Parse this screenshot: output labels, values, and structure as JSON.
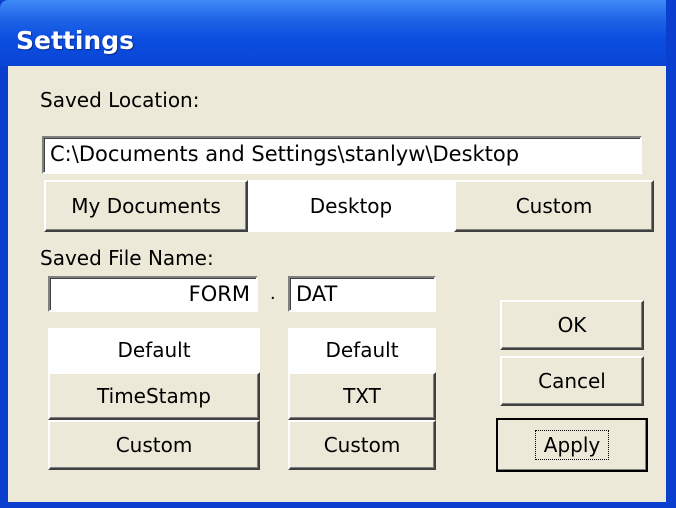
{
  "window": {
    "title": "Settings"
  },
  "location": {
    "label": "Saved Location:",
    "path": "C:\\Documents and Settings\\stanlyw\\Desktop",
    "buttons": [
      "My Documents",
      "Desktop",
      "Custom"
    ]
  },
  "filename": {
    "label": "Saved File Name:",
    "name_value": "FORM",
    "separator": ".",
    "ext_value": "DAT",
    "name_buttons": [
      "Default",
      "TimeStamp",
      "Custom"
    ],
    "ext_buttons": [
      "Default",
      "TXT",
      "Custom"
    ]
  },
  "actions": {
    "ok": "OK",
    "cancel": "Cancel",
    "apply": "Apply"
  }
}
